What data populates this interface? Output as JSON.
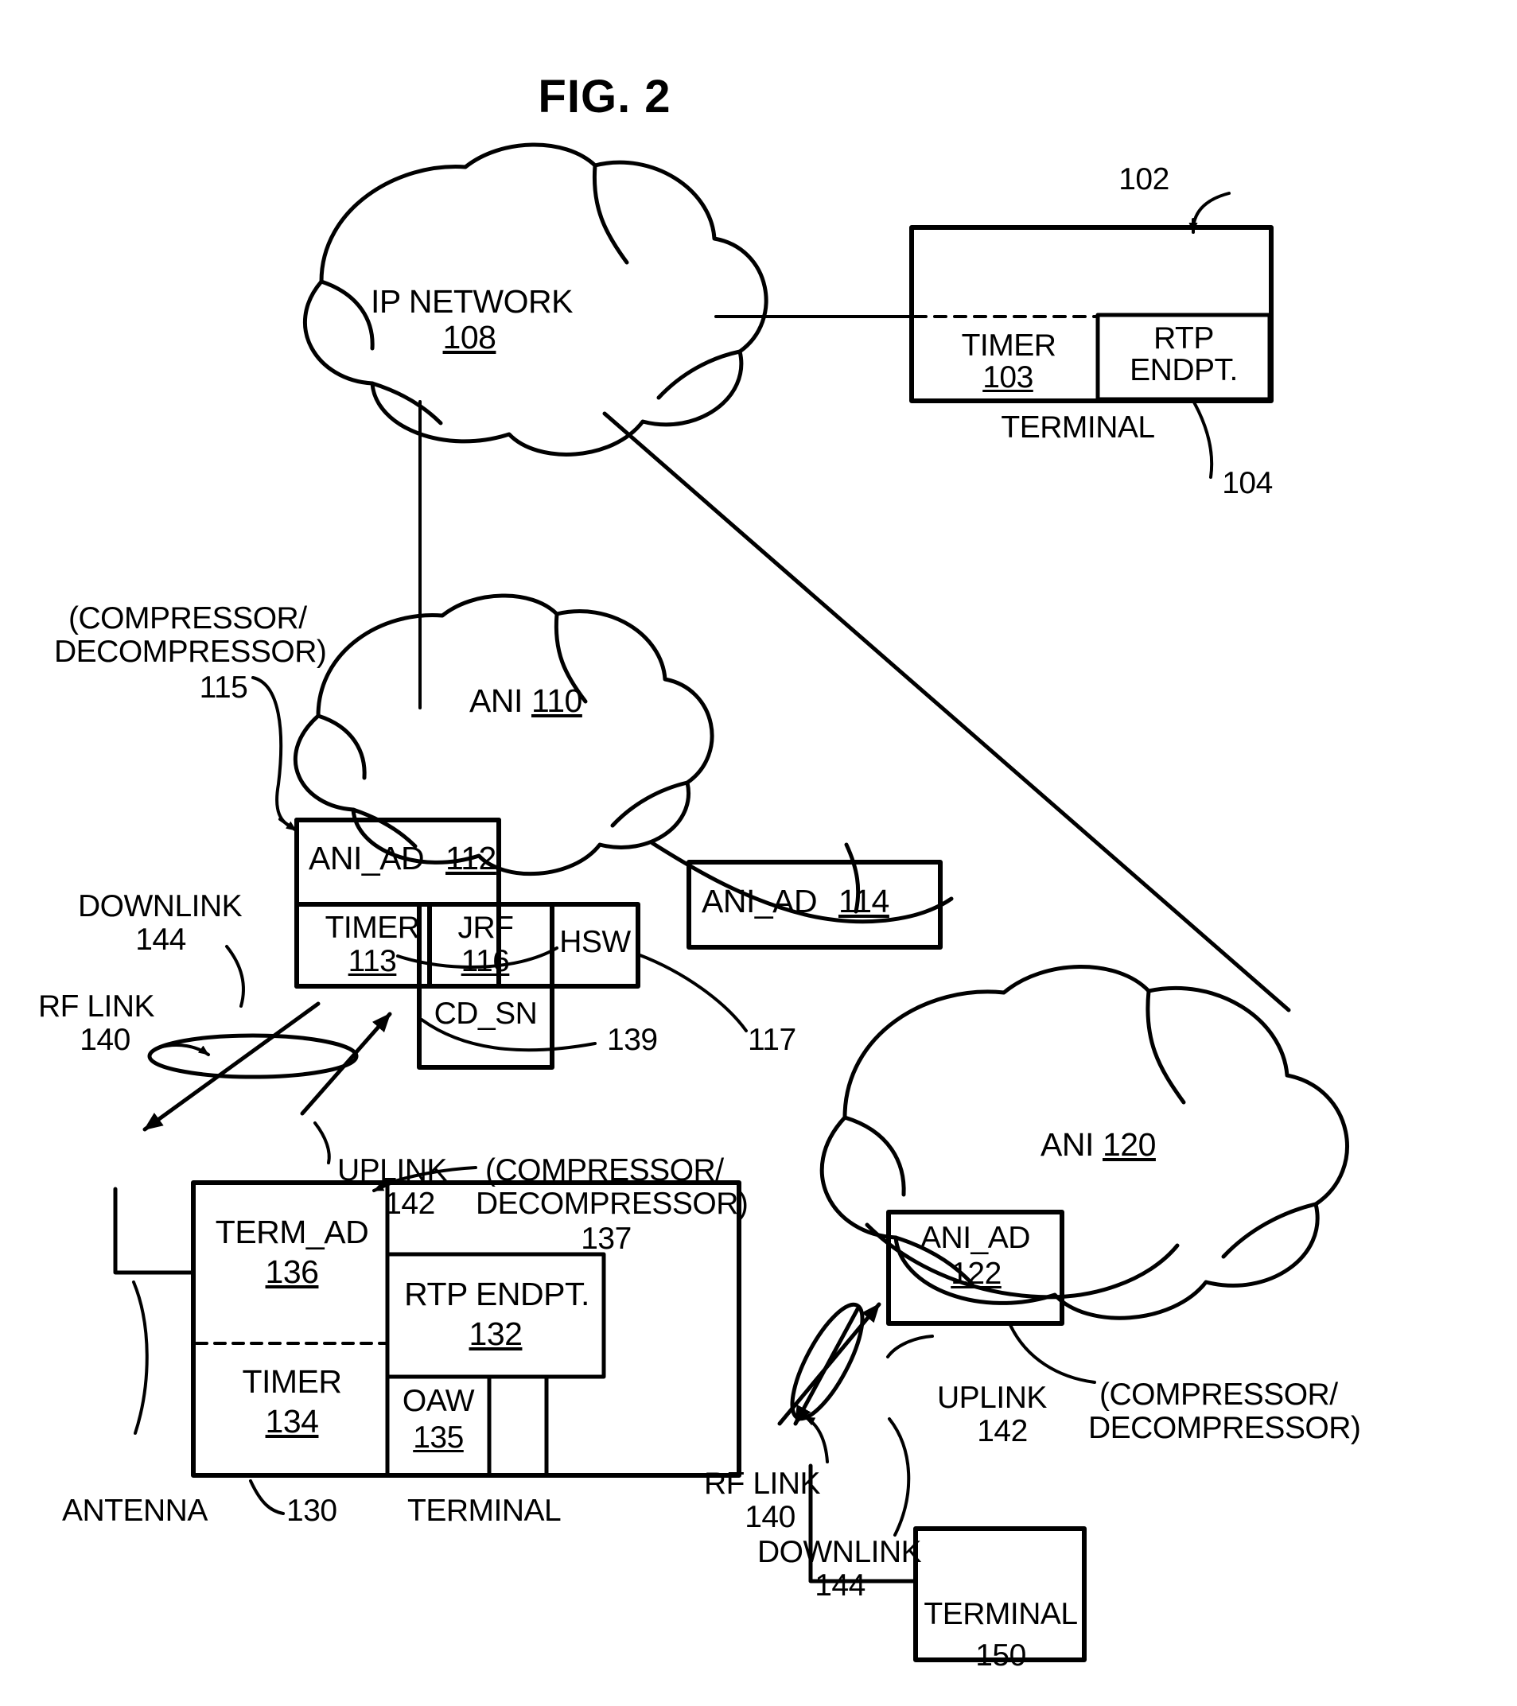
{
  "figure": {
    "title": "FIG. 2"
  },
  "ip_network": {
    "name": "IP NETWORK",
    "ref": "108"
  },
  "terminal_102": {
    "ref": "102",
    "caption": "TERMINAL",
    "timer": {
      "name": "TIMER",
      "ref": "103"
    },
    "rtp_endpoint": {
      "line1": "RTP",
      "line2": "ENDPT.",
      "ref": "104"
    }
  },
  "ani_110": {
    "name": "ANI",
    "ref": "110"
  },
  "ani_ad_112": {
    "name": "ANI_AD",
    "ref": "112",
    "timer": {
      "name": "TIMER",
      "ref": "113"
    },
    "jrf": {
      "name": "JRF",
      "ref": "116"
    },
    "hsw": {
      "name": "HSW",
      "ref": "117"
    },
    "cd_sn": {
      "name": "CD_SN",
      "ref": "139"
    }
  },
  "ani_ad_114": {
    "name": "ANI_AD",
    "ref": "114"
  },
  "ani_120": {
    "name": "ANI",
    "ref": "120"
  },
  "ani_ad_122": {
    "name": "ANI_AD",
    "ref": "122"
  },
  "terminal_130": {
    "ref": "130",
    "caption": "TERMINAL",
    "antenna_label": "ANTENNA",
    "term_ad": {
      "name": "TERM_AD",
      "ref": "136"
    },
    "timer": {
      "name": "TIMER",
      "ref": "134"
    },
    "rtp_endpoint": {
      "name": "RTP ENDPT.",
      "ref": "132"
    },
    "oaw": {
      "name": "OAW",
      "ref": "135"
    }
  },
  "terminal_150": {
    "caption": "TERMINAL",
    "ref": "150"
  },
  "codec_labels": {
    "left_line1": "(COMPRESSOR/",
    "left_line2": "DECOMPRESSOR)",
    "left_ref": "115",
    "mid_line1": "(COMPRESSOR/",
    "mid_line2": "DECOMPRESSOR)",
    "mid_ref": "137",
    "right_line1": "(COMPRESSOR/",
    "right_line2": "DECOMPRESSOR)"
  },
  "links_left": {
    "downlink": "DOWNLINK",
    "downlink_ref": "144",
    "rf_link": "RF LINK",
    "rf_link_ref": "140",
    "uplink": "UPLINK",
    "uplink_ref": "142"
  },
  "links_right": {
    "uplink": "UPLINK",
    "uplink_ref": "142",
    "rf_link": "RF LINK",
    "rf_link_ref": "140",
    "downlink": "DOWNLINK",
    "downlink_ref": "144"
  }
}
